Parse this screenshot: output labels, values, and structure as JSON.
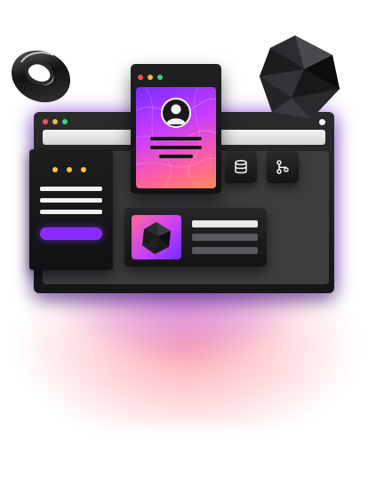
{
  "illustration": {
    "main_window": {
      "dots": [
        "red",
        "yellow",
        "green"
      ]
    },
    "profile_card": {
      "dots": [
        "red",
        "yellow",
        "green"
      ],
      "icon": "user-icon"
    },
    "side_card": {
      "dots": [
        "yellow",
        "yellow",
        "yellow"
      ]
    },
    "buttons": [
      {
        "icon": "database-icon"
      },
      {
        "icon": "git-branch-icon"
      }
    ],
    "decorations": [
      "torus-ring",
      "icosahedron",
      "polyhedron-thumbnail"
    ]
  },
  "colors": {
    "accent_purple": "#8a2cff",
    "accent_pink": "#ff5fa0",
    "dot_red": "#ff5050",
    "dot_yellow": "#ffb347",
    "dot_green": "#38d47a",
    "panel_dark": "#161618"
  }
}
